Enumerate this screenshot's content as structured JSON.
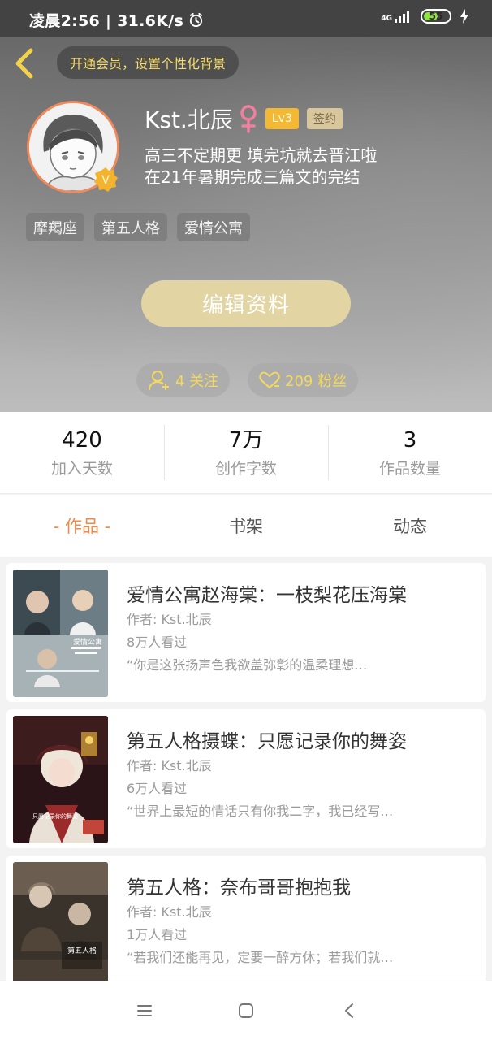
{
  "status_bar": {
    "time_speed": "凌晨2:56 | 31.6K/s",
    "network_tag": "4G",
    "battery": "55",
    "battery_level": 0.55
  },
  "header": {
    "vip_promo": "开通会员，设置个性化背景",
    "username": "Kst.北辰",
    "level": "Lv3",
    "signed": "签约",
    "avatar_badge": "V",
    "bio_line1": "高三不定期更 填完坑就去晋江啦",
    "bio_line2": "在21年暑期完成三篇文的完结",
    "tags": [
      "摩羯座",
      "第五人格",
      "爱情公寓"
    ],
    "edit_button": "编辑资料",
    "following": "4 关注",
    "fans": "209 粉丝"
  },
  "stats": [
    {
      "value": "420",
      "label": "加入天数"
    },
    {
      "value": "7万",
      "label": "创作字数"
    },
    {
      "value": "3",
      "label": "作品数量"
    }
  ],
  "tabs": [
    {
      "label": "- 作品 -",
      "active": true
    },
    {
      "label": "书架",
      "active": false
    },
    {
      "label": "动态",
      "active": false
    }
  ],
  "works": [
    {
      "title": "爱情公寓赵海棠：一枝梨花压海棠",
      "author": "作者: Kst.北辰",
      "views": "8万人看过",
      "desc": "“你是这张扬声色我欲盖弥彰的温柔理想…",
      "cover_text": "爱情公寓"
    },
    {
      "title": "第五人格摄蝶：只愿记录你的舞姿",
      "author": "作者: Kst.北辰",
      "views": "6万人看过",
      "desc": "“世界上最短的情话只有你我二字，我已经写…",
      "cover_text": "只愿记录你的舞姿"
    },
    {
      "title": "第五人格：奈布哥哥抱抱我",
      "author": "作者: Kst.北辰",
      "views": "1万人看过",
      "desc": "“若我们还能再见，定要一醉方休；若我们就…",
      "cover_text": "第五人格"
    }
  ],
  "colors": {
    "accent": "#ef8a4c",
    "gold": "#f4d95c",
    "edit_button": "#e3d4a3"
  },
  "icons": {
    "back": "chevron-left-icon",
    "female": "female-icon",
    "follow": "user-plus-icon",
    "fans": "heart-icon",
    "nav_menu": "menu-icon",
    "nav_home": "home-square-icon",
    "nav_back": "back-chevron-icon"
  }
}
